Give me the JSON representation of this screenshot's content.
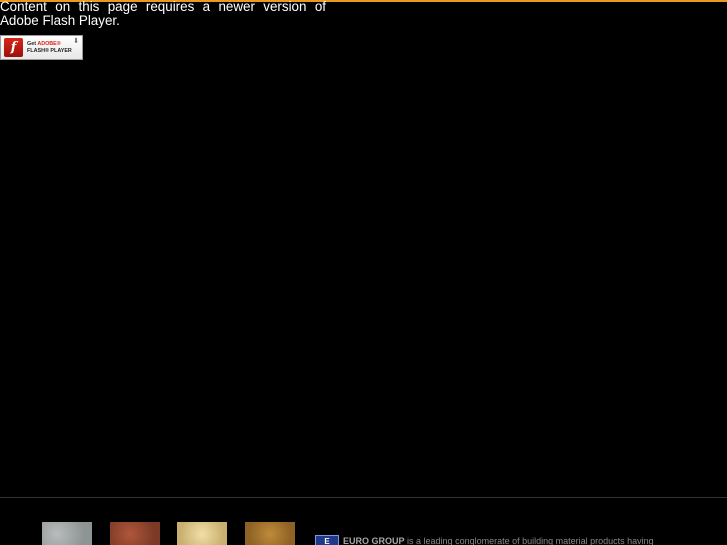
{
  "colors": {
    "background": "#000000",
    "top_rule": "#e89a1e",
    "message_text": "#ffffff",
    "divider": "#333333",
    "adobe_red": "#d8231b",
    "euro_logo_blue": "#1f3a8a"
  },
  "flash_notice": {
    "message": "Content on this page requires a newer version of Adobe Flash Player.",
    "button": {
      "icon": "flash-player-icon",
      "line1_prefix": "Get",
      "line1_brand": "ADOBE®",
      "line2": "FLASH® PLAYER",
      "arrow_icon": "download-arrow-icon"
    }
  },
  "footer": {
    "swatches": [
      {
        "name": "grey-stone-swatch",
        "color": "#a3a8a8"
      },
      {
        "name": "red-stone-swatch",
        "color": "#9b4830"
      },
      {
        "name": "cream-stone-swatch",
        "color": "#e2cd8e"
      },
      {
        "name": "gold-stone-swatch",
        "color": "#ae7a31"
      }
    ],
    "logo": "euro-group-logo",
    "company_name": "EURO GROUP",
    "intro_text": "is a leading conglomerate of building material products having"
  }
}
